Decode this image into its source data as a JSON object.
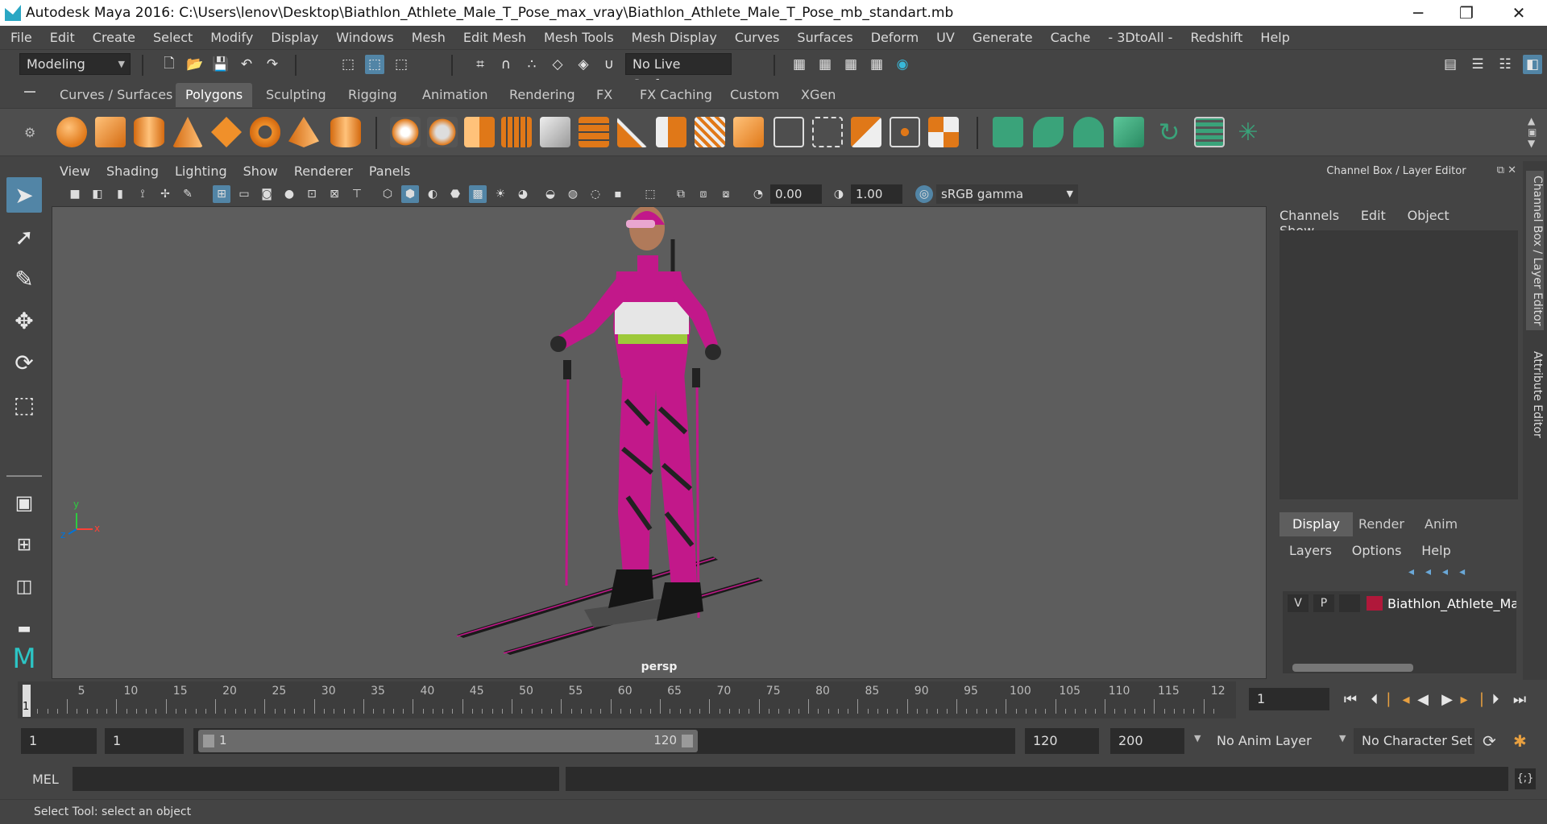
{
  "window": {
    "title": "Autodesk Maya 2016: C:\\Users\\lenov\\Desktop\\Biathlon_Athlete_Male_T_Pose_max_vray\\Biathlon_Athlete_Male_T_Pose_mb_standart.mb",
    "minimize": "─",
    "maximize": "❐",
    "close": "✕"
  },
  "menu": [
    "File",
    "Edit",
    "Create",
    "Select",
    "Modify",
    "Display",
    "Windows",
    "Mesh",
    "Edit Mesh",
    "Mesh Tools",
    "Mesh Display",
    "Curves",
    "Surfaces",
    "Deform",
    "UV",
    "Generate",
    "Cache",
    "- 3DtoAll -",
    "Redshift",
    "Help"
  ],
  "statusline": {
    "mode": "Modeling",
    "live_surface": "No Live Surface"
  },
  "shelf": {
    "tabs": [
      "Curves / Surfaces",
      "Polygons",
      "Sculpting",
      "Rigging",
      "Animation",
      "Rendering",
      "FX",
      "FX Caching",
      "Custom",
      "XGen"
    ],
    "active_tab": "Polygons"
  },
  "viewport": {
    "menu": [
      "View",
      "Shading",
      "Lighting",
      "Show",
      "Renderer",
      "Panels"
    ],
    "exposure": "0.00",
    "gamma": "1.00",
    "color_space": "sRGB gamma",
    "camera_label": "persp",
    "axis_x": "x",
    "axis_y": "y",
    "axis_z": "z"
  },
  "channel_box": {
    "title": "Channel Box / Layer Editor",
    "menu": [
      "Channels",
      "Edit",
      "Object",
      "Show"
    ]
  },
  "layer_editor": {
    "tabs": [
      "Display",
      "Render",
      "Anim"
    ],
    "active_tab": "Display",
    "menu": [
      "Layers",
      "Options",
      "Help"
    ],
    "layer": {
      "v": "V",
      "p": "P",
      "name": "Biathlon_Athlete_Male",
      "color": "#b0183a"
    }
  },
  "side_tabs": [
    "Channel Box / Layer Editor",
    "Attribute Editor"
  ],
  "timeline": {
    "labels": [
      "5",
      "10",
      "15",
      "20",
      "25",
      "30",
      "35",
      "40",
      "45",
      "50",
      "55",
      "60",
      "65",
      "70",
      "75",
      "80",
      "85",
      "90",
      "95",
      "100",
      "105",
      "110",
      "115",
      "12"
    ],
    "current_frame_marker": "1",
    "current_frame": "1"
  },
  "range": {
    "start": "1",
    "playback_start": "1",
    "slider_start": "1",
    "slider_end": "120",
    "playback_end": "120",
    "end": "200",
    "anim_layer": "No Anim Layer",
    "character_set": "No Character Set"
  },
  "command": {
    "lang": "MEL"
  },
  "help_line": "Select Tool: select an object",
  "colors": {
    "accent": "#5285a6",
    "suit": "#c2188a",
    "viewport_bg": "#5d5d5d"
  }
}
